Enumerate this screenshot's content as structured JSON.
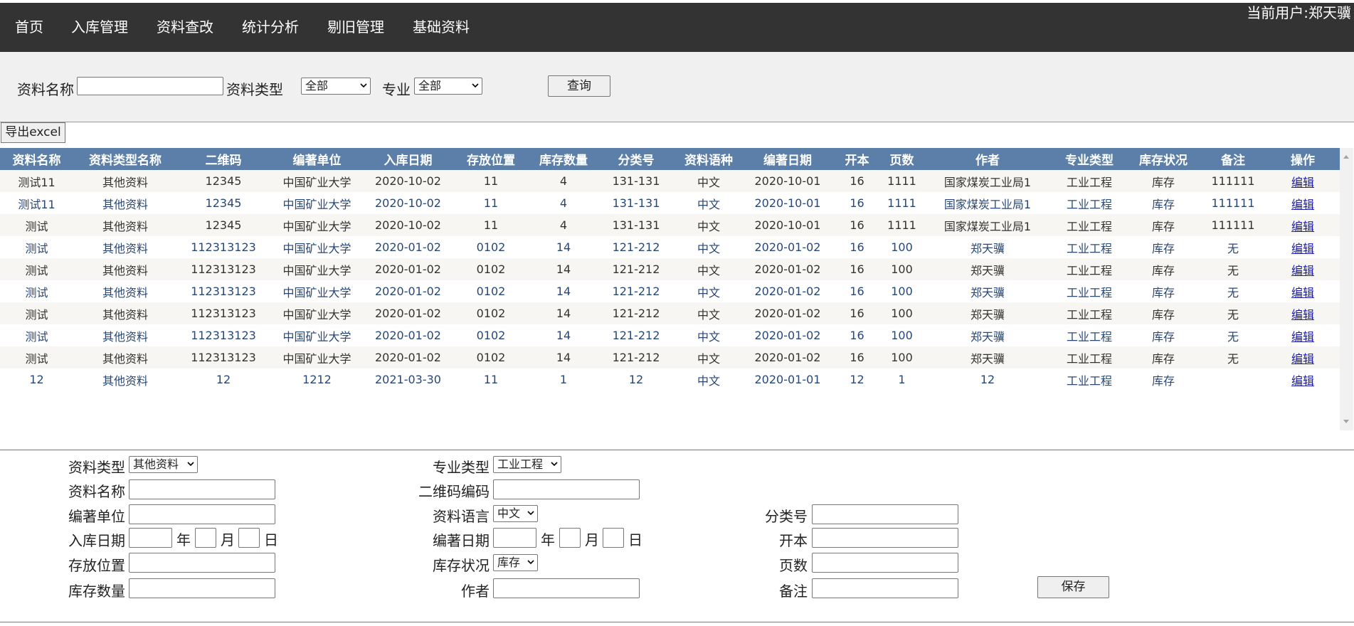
{
  "nav": {
    "items": [
      "首页",
      "入库管理",
      "资料查改",
      "统计分析",
      "剔旧管理",
      "基础资料"
    ],
    "current_user": "当前用户:郑天骥"
  },
  "search": {
    "name_label": "资料名称",
    "name_value": "",
    "type_label": "资料类型",
    "type_value": "全部",
    "major_label": "专业",
    "major_value": "全部",
    "query_button": "查询"
  },
  "export_button": "导出excel",
  "table": {
    "headers": [
      "资料名称",
      "资料类型名称",
      "二维码",
      "编著单位",
      "入库日期",
      "存放位置",
      "库存数量",
      "分类号",
      "资料语种",
      "编著日期",
      "开本",
      "页数",
      "作者",
      "专业类型",
      "库存状况",
      "备注",
      "操作"
    ],
    "rows": [
      [
        "测试11",
        "其他资料",
        "12345",
        "中国矿业大学",
        "2020-10-02",
        "11",
        "4",
        "131-131",
        "中文",
        "2020-10-01",
        "16",
        "1111",
        "国家煤炭工业局1",
        "工业工程",
        "库存",
        "111111",
        "编辑"
      ],
      [
        "测试11",
        "其他资料",
        "12345",
        "中国矿业大学",
        "2020-10-02",
        "11",
        "4",
        "131-131",
        "中文",
        "2020-10-01",
        "16",
        "1111",
        "国家煤炭工业局1",
        "工业工程",
        "库存",
        "111111",
        "编辑"
      ],
      [
        "测试",
        "其他资料",
        "12345",
        "中国矿业大学",
        "2020-10-02",
        "11",
        "4",
        "131-131",
        "中文",
        "2020-10-01",
        "16",
        "1111",
        "国家煤炭工业局1",
        "工业工程",
        "库存",
        "111111",
        "编辑"
      ],
      [
        "测试",
        "其他资料",
        "112313123",
        "中国矿业大学",
        "2020-01-02",
        "0102",
        "14",
        "121-212",
        "中文",
        "2020-01-02",
        "16",
        "100",
        "郑天骥",
        "工业工程",
        "库存",
        "无",
        "编辑"
      ],
      [
        "测试",
        "其他资料",
        "112313123",
        "中国矿业大学",
        "2020-01-02",
        "0102",
        "14",
        "121-212",
        "中文",
        "2020-01-02",
        "16",
        "100",
        "郑天骥",
        "工业工程",
        "库存",
        "无",
        "编辑"
      ],
      [
        "测试",
        "其他资料",
        "112313123",
        "中国矿业大学",
        "2020-01-02",
        "0102",
        "14",
        "121-212",
        "中文",
        "2020-01-02",
        "16",
        "100",
        "郑天骥",
        "工业工程",
        "库存",
        "无",
        "编辑"
      ],
      [
        "测试",
        "其他资料",
        "112313123",
        "中国矿业大学",
        "2020-01-02",
        "0102",
        "14",
        "121-212",
        "中文",
        "2020-01-02",
        "16",
        "100",
        "郑天骥",
        "工业工程",
        "库存",
        "无",
        "编辑"
      ],
      [
        "测试",
        "其他资料",
        "112313123",
        "中国矿业大学",
        "2020-01-02",
        "0102",
        "14",
        "121-212",
        "中文",
        "2020-01-02",
        "16",
        "100",
        "郑天骥",
        "工业工程",
        "库存",
        "无",
        "编辑"
      ],
      [
        "测试",
        "其他资料",
        "112313123",
        "中国矿业大学",
        "2020-01-02",
        "0102",
        "14",
        "121-212",
        "中文",
        "2020-01-02",
        "16",
        "100",
        "郑天骥",
        "工业工程",
        "库存",
        "无",
        "编辑"
      ],
      [
        "12",
        "其他资料",
        "12",
        "1212",
        "2021-03-30",
        "11",
        "1",
        "12",
        "中文",
        "2020-01-01",
        "12",
        "1",
        "12",
        "工业工程",
        "库存",
        "",
        "编辑"
      ]
    ]
  },
  "form": {
    "type_label": "资料类型",
    "type_value": "其他资料",
    "major_label": "专业类型",
    "major_value": "工业工程",
    "name_label": "资料名称",
    "name_value": "",
    "qrcode_label": "二维码编码",
    "qrcode_value": "",
    "unit_label": "编著单位",
    "unit_value": "",
    "lang_label": "资料语言",
    "lang_value": "中文",
    "class_label": "分类号",
    "class_value": "",
    "indate_label": "入库日期",
    "edate_label": "编著日期",
    "year": "年",
    "month": "月",
    "day": "日",
    "format_label": "开本",
    "format_value": "",
    "location_label": "存放位置",
    "location_value": "",
    "status_label": "库存状况",
    "status_value": "库存",
    "pages_label": "页数",
    "pages_value": "",
    "qty_label": "库存数量",
    "qty_value": "",
    "author_label": "作者",
    "author_value": "",
    "remark_label": "备注",
    "remark_value": "",
    "save_button": "保存"
  }
}
